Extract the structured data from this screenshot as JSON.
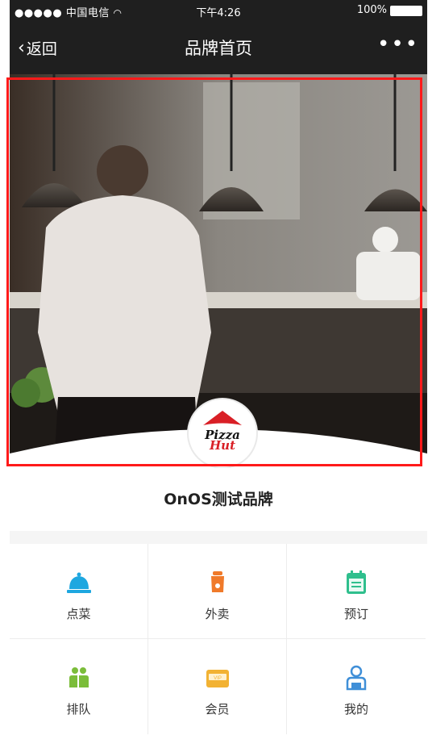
{
  "status_bar": {
    "signal": "●●●●● 中国电信",
    "time": "下午4:26",
    "battery": "100%"
  },
  "navbar": {
    "back_label": "返回",
    "title": "品牌首页",
    "more": "•••"
  },
  "logo": {
    "line1": "Pizza",
    "line2": "Hut"
  },
  "brand": {
    "name": "OnOS测试品牌"
  },
  "grid": {
    "items": [
      {
        "label": "点菜",
        "icon": "dining-bell-icon",
        "color": "#1ea7e0"
      },
      {
        "label": "外卖",
        "icon": "scooter-icon",
        "color": "#f07a2a"
      },
      {
        "label": "预订",
        "icon": "calendar-icon",
        "color": "#2fbf8d"
      },
      {
        "label": "排队",
        "icon": "queue-people-icon",
        "color": "#7bbd3a"
      },
      {
        "label": "会员",
        "icon": "vip-card-icon",
        "color": "#f2b233"
      },
      {
        "label": "我的",
        "icon": "user-icon",
        "color": "#3f8fd8"
      }
    ]
  }
}
